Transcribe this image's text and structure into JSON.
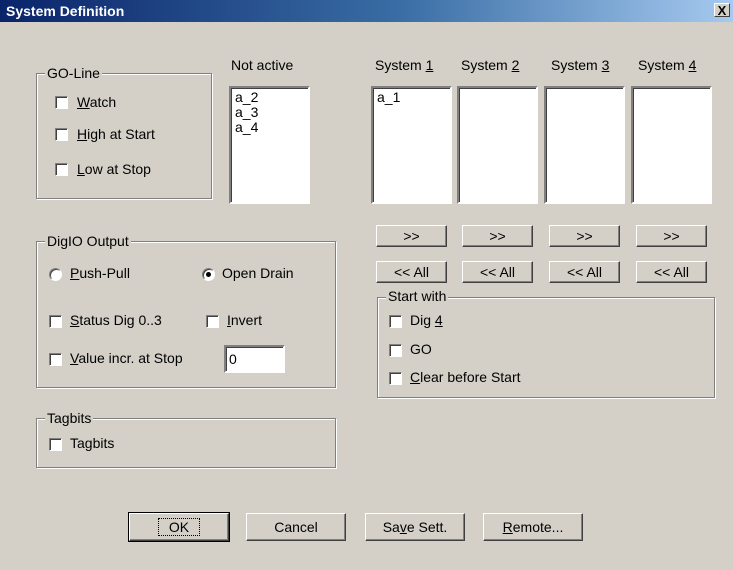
{
  "window": {
    "title": "System Definition",
    "close_label": "X"
  },
  "go_line": {
    "title": "GO-Line",
    "watch": {
      "pre": "",
      "key": "W",
      "post": "atch"
    },
    "high": {
      "pre": "",
      "key": "H",
      "post": "igh at Start"
    },
    "low": {
      "pre": "",
      "key": "L",
      "post": "ow at Stop"
    }
  },
  "not_active": {
    "label": "Not active",
    "items": [
      "a_2",
      "a_3",
      "a_4"
    ]
  },
  "systems": [
    {
      "pre": "System ",
      "key": "1",
      "items": [
        "a_1"
      ],
      "move_label": ">>",
      "all_label": "<< All"
    },
    {
      "pre": "System ",
      "key": "2",
      "items": [],
      "move_label": ">>",
      "all_label": "<< All"
    },
    {
      "pre": "System ",
      "key": "3",
      "items": [],
      "move_label": ">>",
      "all_label": "<< All"
    },
    {
      "pre": "System ",
      "key": "4",
      "items": [],
      "move_label": ">>",
      "all_label": "<< All"
    }
  ],
  "digio": {
    "title": "DigIO Output",
    "push_pull": {
      "pre": "",
      "key": "P",
      "post": "ush-Pull",
      "selected": false
    },
    "open_drain": {
      "label": "Open Drain",
      "selected": true
    },
    "status": {
      "pre": "",
      "key": "S",
      "post": "tatus Dig 0..3"
    },
    "invert": {
      "pre": "",
      "key": "I",
      "post": "nvert"
    },
    "value_incr": {
      "pre": "",
      "key": "V",
      "post": "alue incr. at Stop"
    },
    "value": "0"
  },
  "tagbits": {
    "title": "Tagbits",
    "check_label": "Tagbits"
  },
  "start_with": {
    "title": "Start with",
    "dig4": {
      "pre": "Dig ",
      "key": "4",
      "post": ""
    },
    "go": {
      "label": "GO"
    },
    "clear": {
      "pre": "",
      "key": "C",
      "post": "lear before Start"
    }
  },
  "buttons": {
    "ok": "OK",
    "cancel": "Cancel",
    "save": {
      "pre": "Sa",
      "key": "v",
      "post": "e Sett."
    },
    "remote": {
      "pre": "",
      "key": "R",
      "post": "emote..."
    }
  }
}
